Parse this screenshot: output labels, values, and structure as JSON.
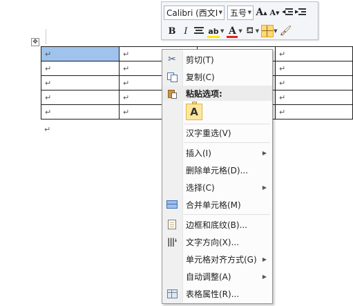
{
  "document": {
    "cell_mark": "↵",
    "paragraph_mark": "↵",
    "table_move_handle": "✥",
    "rows": 5,
    "columns": 4,
    "selected_cells": [
      [
        0,
        0
      ]
    ]
  },
  "mini_toolbar": {
    "font_name": "Calibri (西文Ⅰ",
    "font_size": "五号",
    "grow_font_label": "A",
    "shrink_font_label": "A",
    "bold_label": "B",
    "italic_label": "I",
    "highlight_label": "ab",
    "font_color_label": "A",
    "colors": {
      "highlight": "#ffe800",
      "font_color": "#e32020",
      "selection": "#9fc3ec"
    }
  },
  "context_menu": {
    "items": [
      {
        "label": "剪切(T)",
        "icon": "scissors-icon"
      },
      {
        "label": "复制(C)",
        "icon": "copy-icon"
      },
      {
        "label": "粘贴选项:",
        "icon": "paste-icon",
        "header": true
      },
      {
        "label": "A",
        "icon": "keep-text-only-icon"
      },
      {
        "label": "汉字重选(V)"
      },
      {
        "label": "插入(I)",
        "submenu": true
      },
      {
        "label": "删除单元格(D)..."
      },
      {
        "label": "选择(C)",
        "submenu": true
      },
      {
        "label": "合并单元格(M)",
        "icon": "merge-cells-icon"
      },
      {
        "label": "边框和底纹(B)...",
        "icon": "borders-shading-icon"
      },
      {
        "label": "文字方向(X)...",
        "icon": "text-direction-icon"
      },
      {
        "label": "单元格对齐方式(G)",
        "submenu": true
      },
      {
        "label": "自动调整(A)",
        "submenu": true
      },
      {
        "label": "表格属性(R)...",
        "icon": "table-properties-icon"
      }
    ]
  }
}
